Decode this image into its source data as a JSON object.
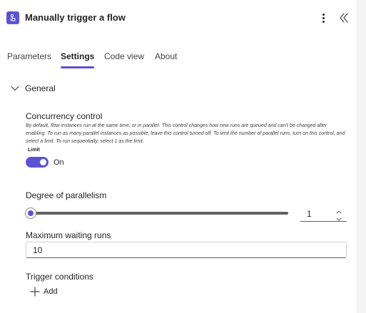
{
  "header": {
    "title": "Manually trigger a flow",
    "app_icon": "touch-trigger-icon",
    "more_icon": "more-vertical-icon",
    "collapse_icon": "double-chevron-left-icon",
    "accent_color": "#5d52d6"
  },
  "tabs": [
    {
      "label": "Parameters",
      "active": false
    },
    {
      "label": "Settings",
      "active": true
    },
    {
      "label": "Code view",
      "active": false
    },
    {
      "label": "About",
      "active": false
    }
  ],
  "section": {
    "label": "General",
    "icon": "chevron-down-icon",
    "expanded": true
  },
  "concurrency": {
    "label": "Concurrency control",
    "description": "By default, flow instances run at the same time, or in parallel. This control changes how new runs are queued and can't be changed after enabling. To run as many parallel instances as possible, leave this control turned off. To limit the number of parallel runs, turn on this control, and select a limit. To run sequentially, select 1 as the limit.",
    "limit_label": "Limit",
    "toggle_state": "On",
    "toggle_on": true
  },
  "parallelism": {
    "label": "Degree of parallelism",
    "value": "1",
    "slider_fraction": 0,
    "up_icon": "chevron-up-icon",
    "down_icon": "chevron-down-icon"
  },
  "waiting_runs": {
    "label": "Maximum waiting runs",
    "value": "10"
  },
  "trigger_conditions": {
    "label": "Trigger conditions",
    "add_label": "Add",
    "add_icon": "plus-icon"
  }
}
